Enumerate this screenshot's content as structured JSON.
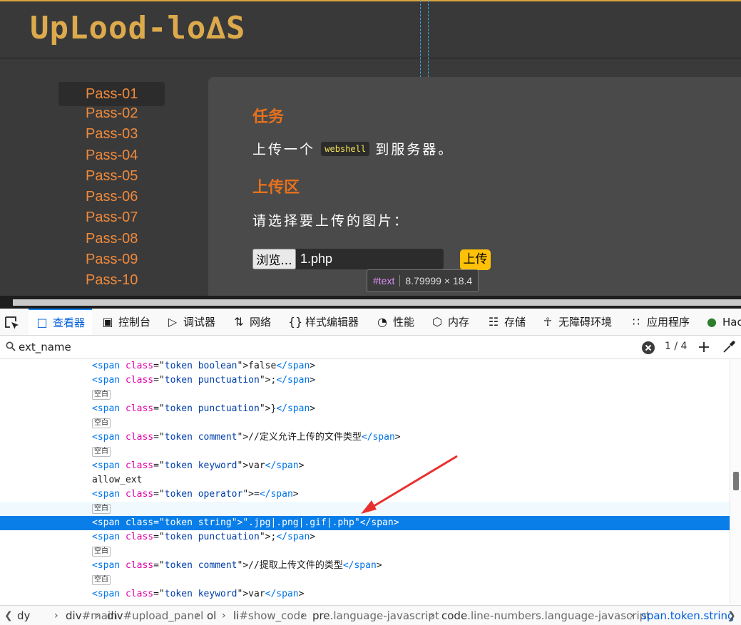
{
  "site": {
    "logo_text": "UpLood-lo∆S",
    "menu": [
      "Pass-01",
      "Pass-02",
      "Pass-03",
      "Pass-04",
      "Pass-05",
      "Pass-06",
      "Pass-07",
      "Pass-08",
      "Pass-09",
      "Pass-10"
    ],
    "task_title": "任务",
    "task_prefix": "上传一个",
    "task_code": "webshell",
    "task_suffix": "到服务器。",
    "upload_title": "上传区",
    "select_label": "请选择要上传的图片：",
    "browse_label": "浏览...",
    "file_name": "1.php",
    "upload_label": "上传",
    "tooltip_node": "#text",
    "tooltip_size": "8.79999 × 18.4"
  },
  "devtools": {
    "tabs": [
      {
        "label": "查看器",
        "icon": "inspector-icon"
      },
      {
        "label": "控制台",
        "icon": "console-icon"
      },
      {
        "label": "调试器",
        "icon": "debugger-icon"
      },
      {
        "label": "网络",
        "icon": "network-icon"
      },
      {
        "label": "样式编辑器",
        "icon": "style-editor-icon"
      },
      {
        "label": "性能",
        "icon": "performance-icon"
      },
      {
        "label": "内存",
        "icon": "memory-icon"
      },
      {
        "label": "存储",
        "icon": "storage-icon"
      },
      {
        "label": "无障碍环境",
        "icon": "accessibility-icon"
      },
      {
        "label": "应用程序",
        "icon": "application-icon"
      },
      {
        "label": "Hac",
        "icon": "hackbar-icon"
      }
    ],
    "search_value": "ext_name",
    "match_count": "1 / 4",
    "whitespace_badge": "空白",
    "rows": [
      {
        "kind": "span",
        "cls": "token boolean",
        "text": "false"
      },
      {
        "kind": "span",
        "cls": "token punctuation",
        "text": ";"
      },
      {
        "kind": "ws"
      },
      {
        "kind": "span",
        "cls": "token punctuation",
        "text": "}"
      },
      {
        "kind": "ws"
      },
      {
        "kind": "span",
        "cls": "token comment",
        "text": "//定义允许上传的文件类型"
      },
      {
        "kind": "ws"
      },
      {
        "kind": "span",
        "cls": "token keyword",
        "text": "var"
      },
      {
        "kind": "text",
        "text": "allow_ext"
      },
      {
        "kind": "span",
        "cls": "token operator",
        "text": "="
      },
      {
        "kind": "ws"
      },
      {
        "kind": "span",
        "cls": "token string",
        "text": "\".jpg|.png|.gif|.php\"",
        "selected": true
      },
      {
        "kind": "span",
        "cls": "token punctuation",
        "text": ";"
      },
      {
        "kind": "ws"
      },
      {
        "kind": "span",
        "cls": "token comment",
        "text": "//提取上传文件的类型"
      },
      {
        "kind": "ws"
      },
      {
        "kind": "span",
        "cls": "token keyword",
        "text": "var"
      }
    ],
    "breadcrumbs": [
      {
        "main": "dy",
        "sub": ""
      },
      {
        "main": "div",
        "sub": "#main"
      },
      {
        "main": "div",
        "sub": "#upload_panel"
      },
      {
        "main": "ol",
        "sub": ""
      },
      {
        "main": "li",
        "sub": "#show_code"
      },
      {
        "main": "pre",
        "sub": ".language-javascript"
      },
      {
        "main": "code",
        "sub": ".line-numbers.language-javascript"
      },
      {
        "main": "span.token.string",
        "sub": "",
        "active": true
      }
    ]
  }
}
